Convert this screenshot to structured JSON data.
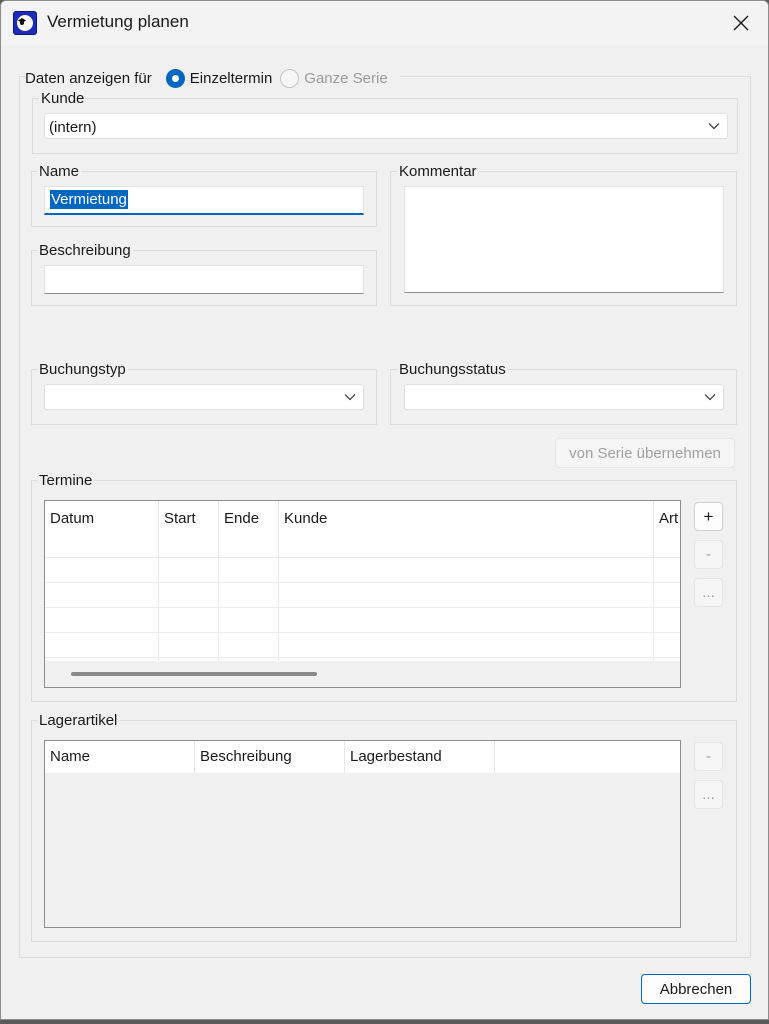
{
  "window": {
    "title": "Vermietung planen"
  },
  "display_for": {
    "label": "Daten anzeigen für",
    "options": [
      {
        "label": "Einzeltermin",
        "selected": true,
        "enabled": true
      },
      {
        "label": "Ganze Serie",
        "selected": false,
        "enabled": false
      }
    ]
  },
  "kunde": {
    "label": "Kunde",
    "value": "(intern)"
  },
  "name": {
    "label": "Name",
    "value": "Vermietung"
  },
  "kommentar": {
    "label": "Kommentar",
    "value": ""
  },
  "beschreibung": {
    "label": "Beschreibung",
    "value": ""
  },
  "buchungstyp": {
    "label": "Buchungstyp",
    "value": ""
  },
  "buchungsstatus": {
    "label": "Buchungsstatus",
    "value": ""
  },
  "von_serie_button": "von Serie übernehmen",
  "termine": {
    "label": "Termine",
    "columns": [
      "Datum",
      "Start",
      "Ende",
      "Kunde",
      "Art"
    ],
    "add_label": "+",
    "remove_label": "-",
    "more_label": "..."
  },
  "lagerartikel": {
    "label": "Lagerartikel",
    "columns": [
      "Name",
      "Beschreibung",
      "Lagerbestand"
    ],
    "remove_label": "-",
    "more_label": "..."
  },
  "cancel_button": "Abbrechen",
  "colors": {
    "accent": "#0067c0",
    "window_bg": "#f0f0f0"
  }
}
